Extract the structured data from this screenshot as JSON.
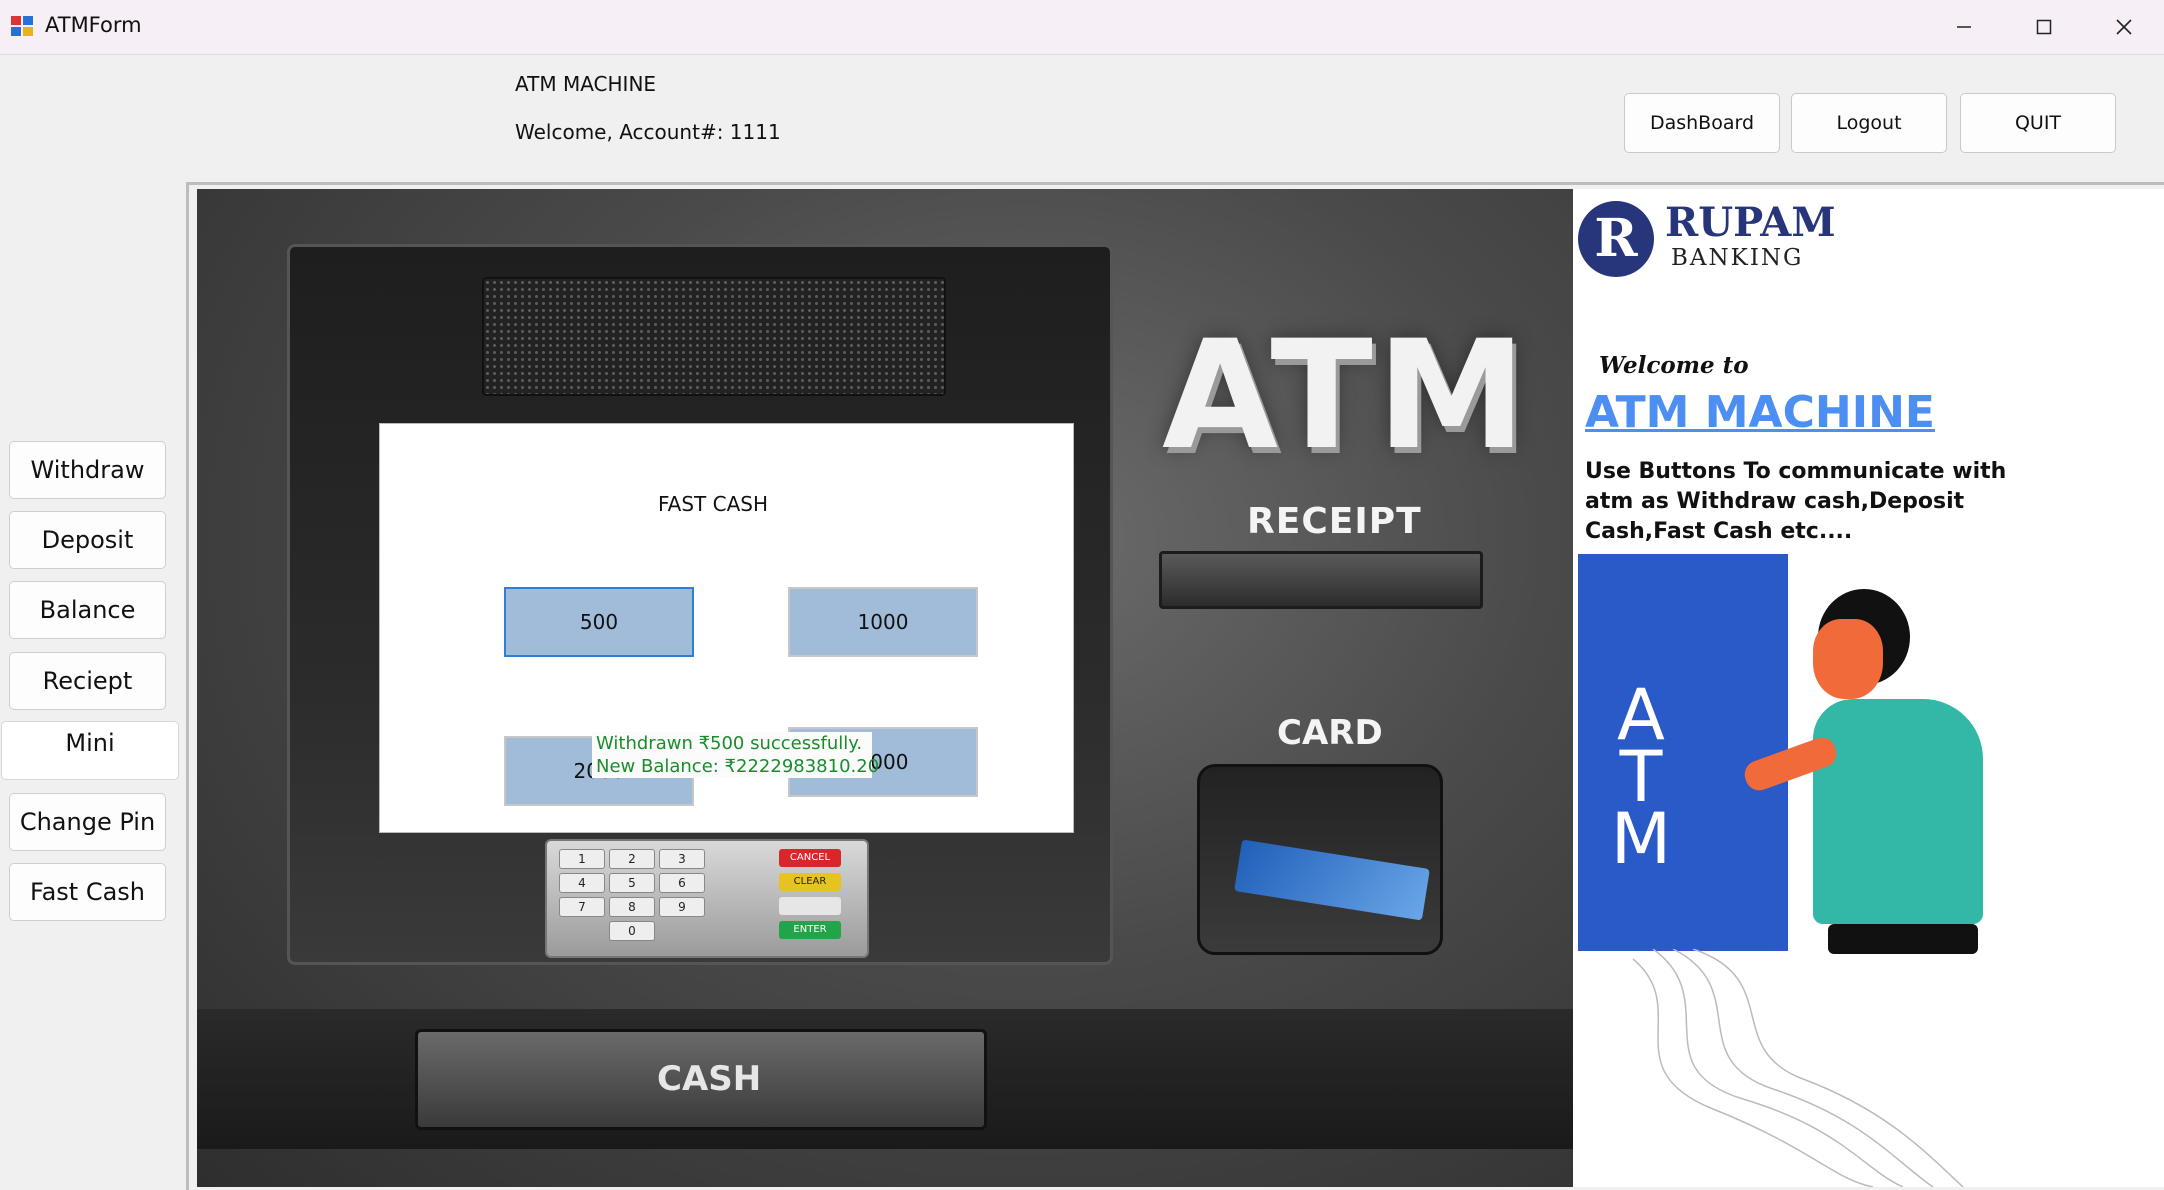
{
  "window": {
    "title": "ATMForm",
    "controls": {
      "minimize": "minimize-icon",
      "maximize": "maximize-icon",
      "close": "close-icon"
    }
  },
  "header": {
    "app_label": "ATM MACHINE",
    "welcome": "Welcome, Account#: 1111",
    "buttons": {
      "dashboard": "DashBoard",
      "logout": "Logout",
      "quit": "QUIT"
    }
  },
  "sidebar": {
    "items": [
      {
        "label": "Withdraw"
      },
      {
        "label": "Deposit"
      },
      {
        "label": "Balance"
      },
      {
        "label": "Reciept"
      },
      {
        "label": "Mini"
      },
      {
        "label": "Change Pin"
      },
      {
        "label": "Fast Cash"
      }
    ],
    "active_index": 4
  },
  "atm_screen": {
    "title": "FAST CASH",
    "amounts": [
      "500",
      "1000",
      "2000",
      "5000"
    ],
    "selected_amount": "500",
    "message_line1": "Withdrawn ₹500 successfully.",
    "message_line2": "New Balance: ₹2222983810.20",
    "message_color": "#1a8c2b"
  },
  "atm_machine": {
    "atm_text": "ATM",
    "receipt_label": "RECEIPT",
    "card_label": "CARD",
    "cash_label": "CASH",
    "keypad_keys": [
      "1",
      "2",
      "3",
      "4",
      "5",
      "6",
      "7",
      "8",
      "9",
      "0"
    ],
    "function_keys": [
      "CANCEL",
      "CLEAR",
      "",
      "ENTER"
    ]
  },
  "promo": {
    "brand_name": "RUPAM",
    "brand_sub": "BANKING",
    "welcome_to": "Welcome to",
    "heading": "ATM MACHINE",
    "body": "Use Buttons To communicate with atm as Withdraw cash,Deposit Cash,Fast Cash etc....",
    "illustration_atm_text": "A T M",
    "colors": {
      "brand": "#27357a",
      "heading": "#4d8ef3"
    }
  }
}
